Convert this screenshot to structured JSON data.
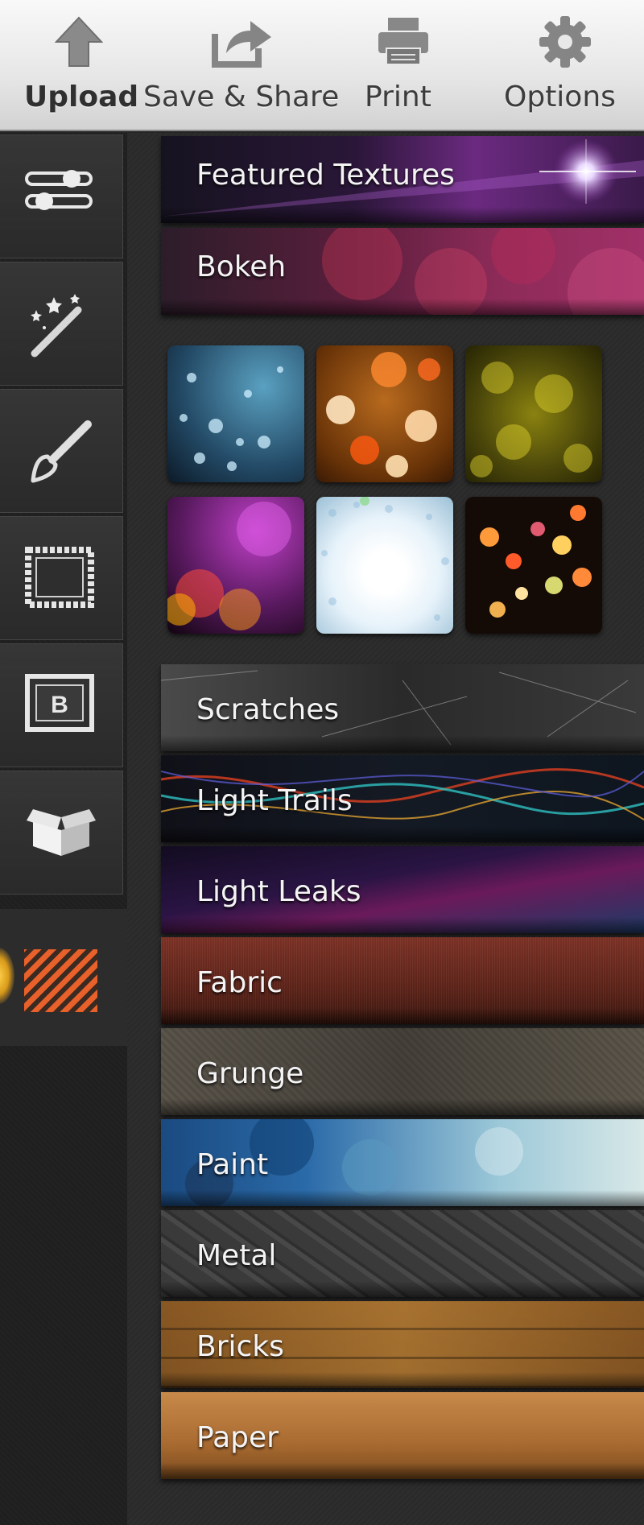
{
  "toolbar": {
    "upload_label": "Upload",
    "save_share_label": "Save & Share",
    "print_label": "Print",
    "options_label": "Options"
  },
  "sidebar": {
    "items": [
      {
        "name": "sliders-icon"
      },
      {
        "name": "magic-wand-icon"
      },
      {
        "name": "paintbrush-icon"
      },
      {
        "name": "frame-icon"
      },
      {
        "name": "text-b-icon"
      },
      {
        "name": "box-icon"
      },
      {
        "name": "textures-icon",
        "active": true
      }
    ],
    "active_color": "#e8602a"
  },
  "categories": {
    "featured": "Featured Textures",
    "bokeh": "Bokeh",
    "scratches": "Scratches",
    "light_trails": "Light Trails",
    "light_leaks": "Light Leaks",
    "fabric": "Fabric",
    "grunge": "Grunge",
    "paint": "Paint",
    "metal": "Metal",
    "bricks": "Bricks",
    "paper": "Paper"
  },
  "bokeh_thumbnails": [
    {
      "name": "blue-bokeh"
    },
    {
      "name": "orange-bokeh"
    },
    {
      "name": "yellow-bokeh"
    },
    {
      "name": "pink-bokeh"
    },
    {
      "name": "white-bokeh"
    },
    {
      "name": "multicolor-bokeh"
    }
  ]
}
